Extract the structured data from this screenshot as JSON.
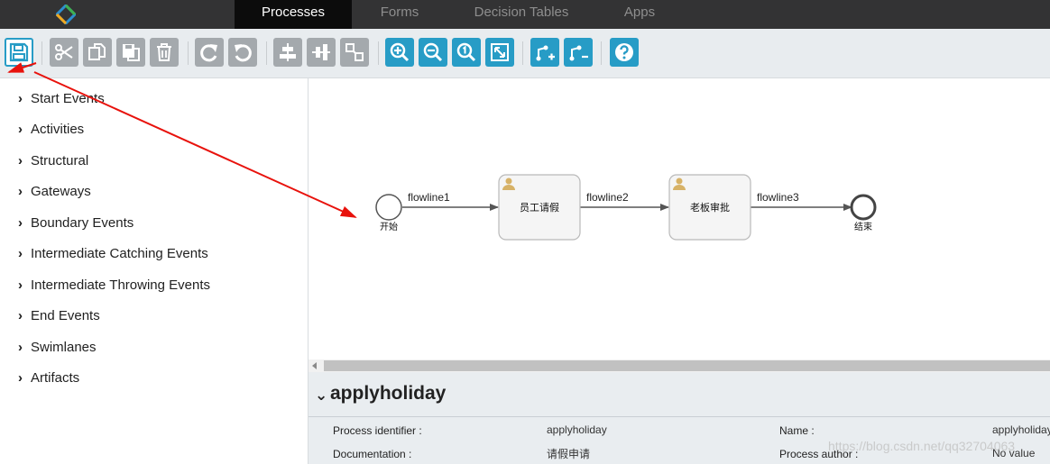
{
  "nav": {
    "tabs": [
      {
        "label": "Processes",
        "active": true
      },
      {
        "label": "Forms",
        "active": false
      },
      {
        "label": "Decision Tables",
        "active": false
      },
      {
        "label": "Apps",
        "active": false
      }
    ]
  },
  "toolbar": {
    "buttons": [
      {
        "name": "save-model-button",
        "icon": "save-icon"
      },
      {
        "name": "cut-button",
        "icon": "scissors-icon"
      },
      {
        "name": "copy-button",
        "icon": "copy-icon"
      },
      {
        "name": "paste-button",
        "icon": "paste-icon"
      },
      {
        "name": "delete-button",
        "icon": "trash-icon"
      },
      {
        "name": "redo-button",
        "icon": "redo-icon"
      },
      {
        "name": "undo-button",
        "icon": "undo-icon"
      },
      {
        "name": "align-horizontal-button",
        "icon": "align-horizontal-icon"
      },
      {
        "name": "align-vertical-button",
        "icon": "align-vertical-icon"
      },
      {
        "name": "same-size-button",
        "icon": "same-size-icon"
      },
      {
        "name": "zoom-in-button",
        "icon": "zoom-in-icon"
      },
      {
        "name": "zoom-out-button",
        "icon": "zoom-out-icon"
      },
      {
        "name": "zoom-actual-button",
        "icon": "zoom-actual-icon"
      },
      {
        "name": "zoom-fit-button",
        "icon": "fit-icon"
      },
      {
        "name": "add-bendpoint-button",
        "icon": "add-bendpoint-icon"
      },
      {
        "name": "remove-bendpoint-button",
        "icon": "remove-bendpoint-icon"
      },
      {
        "name": "help-button",
        "icon": "help-icon"
      }
    ]
  },
  "palette": {
    "items": [
      "Start Events",
      "Activities",
      "Structural",
      "Gateways",
      "Boundary Events",
      "Intermediate Catching Events",
      "Intermediate Throwing Events",
      "End Events",
      "Swimlanes",
      "Artifacts"
    ]
  },
  "diagram": {
    "start_label": "开始",
    "end_label": "结束",
    "task1_label": "员工请假",
    "task2_label": "老板审批",
    "flow1_label": "flowline1",
    "flow2_label": "flowline2",
    "flow3_label": "flowline3",
    "task_icon": "user-icon"
  },
  "properties": {
    "title": "applyholiday",
    "process_identifier_label": "Process identifier :",
    "process_identifier_value": "applyholiday",
    "documentation_label": "Documentation :",
    "documentation_value": "请假申请",
    "name_label": "Name :",
    "name_value": "applyholiday",
    "author_label": "Process author :",
    "author_value": "No value"
  },
  "watermark": "https://blog.csdn.net/qq32704063",
  "colors": {
    "accent": "#279cc6",
    "topbar": "#333334",
    "annotation": "#e8120c"
  }
}
